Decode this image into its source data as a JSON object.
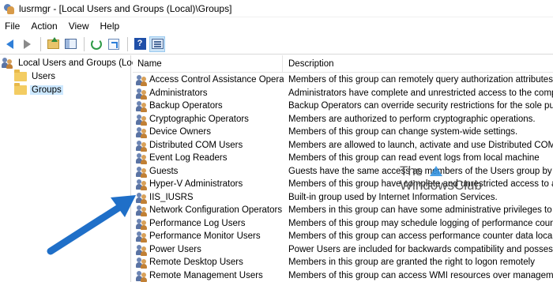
{
  "window": {
    "title": "lusrmgr - [Local Users and Groups (Local)\\Groups]"
  },
  "menu": [
    "File",
    "Action",
    "View",
    "Help"
  ],
  "toolbar": {
    "buttons": [
      "back-icon",
      "forward-icon",
      "up-folder-icon",
      "show-hide-console-tree-icon",
      "refresh-icon",
      "export-list-icon",
      "help-icon",
      "view-icon"
    ]
  },
  "tree": {
    "root": "Local Users and Groups (Local)",
    "items": [
      "Users",
      "Groups"
    ],
    "selected": "Groups"
  },
  "list": {
    "columns": [
      "Name",
      "Description"
    ],
    "rows": [
      {
        "name": "Access Control Assistance Operators",
        "description": "Members of this group can remotely query authorization attributes ..."
      },
      {
        "name": "Administrators",
        "description": "Administrators have complete and unrestricted access to the comp..."
      },
      {
        "name": "Backup Operators",
        "description": "Backup Operators can override security restrictions for the sole purp..."
      },
      {
        "name": "Cryptographic Operators",
        "description": "Members are authorized to perform cryptographic operations."
      },
      {
        "name": "Device Owners",
        "description": "Members of this group can change system-wide settings."
      },
      {
        "name": "Distributed COM Users",
        "description": "Members are allowed to launch, activate and use Distributed COM ..."
      },
      {
        "name": "Event Log Readers",
        "description": "Members of this group can read event logs from local machine"
      },
      {
        "name": "Guests",
        "description": "Guests have the same access as members of the Users group by def..."
      },
      {
        "name": "Hyper-V Administrators",
        "description": "Members of this group have complete and unrestricted access to all..."
      },
      {
        "name": "IIS_IUSRS",
        "description": "Built-in group used by Internet Information Services."
      },
      {
        "name": "Network Configuration Operators",
        "description": "Members in this group can have some administrative privileges to ..."
      },
      {
        "name": "Performance Log Users",
        "description": "Members of this group may schedule logging of performance coun..."
      },
      {
        "name": "Performance Monitor Users",
        "description": "Members of this group can access performance counter data locally..."
      },
      {
        "name": "Power Users",
        "description": "Power Users are included for backwards compatibility and possess li..."
      },
      {
        "name": "Remote Desktop Users",
        "description": "Members in this group are granted the right to logon remotely"
      },
      {
        "name": "Remote Management Users",
        "description": "Members of this group can access WMI resources over managemen..."
      }
    ]
  },
  "watermark": {
    "line1": "The",
    "line2": "WindowsClub"
  },
  "colors": {
    "selection": "#cce8ff",
    "arrow": "#1f6fc8",
    "back_arrow": "#2f7fd8"
  }
}
